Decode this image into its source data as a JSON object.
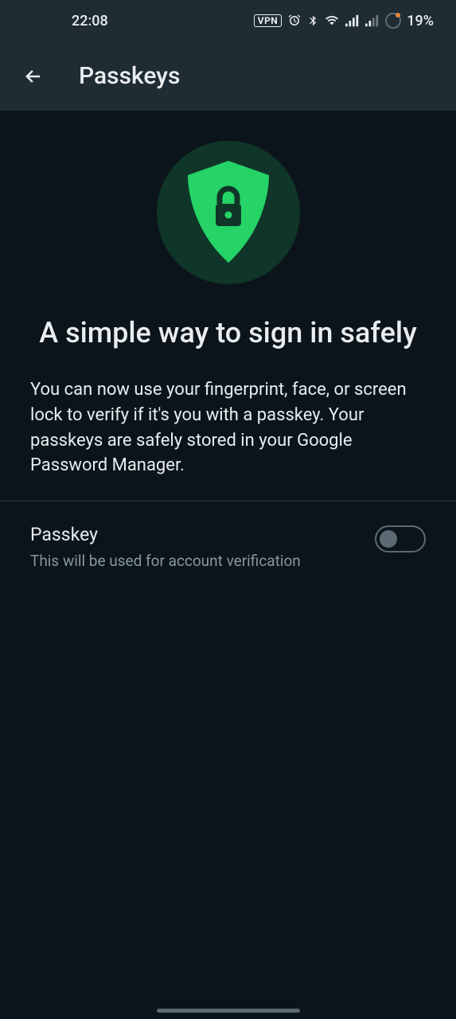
{
  "status": {
    "time": "22:08",
    "vpn": "VPN",
    "battery": "19%"
  },
  "appbar": {
    "title": "Passkeys"
  },
  "hero": {
    "heading": "A simple way to sign in safely",
    "description": "You can now use your fingerprint, face, or screen lock to verify if it's you with a passkey. Your passkeys are safely stored in your Google Password Manager."
  },
  "setting": {
    "label": "Passkey",
    "sublabel": "This will be used for account verification"
  }
}
